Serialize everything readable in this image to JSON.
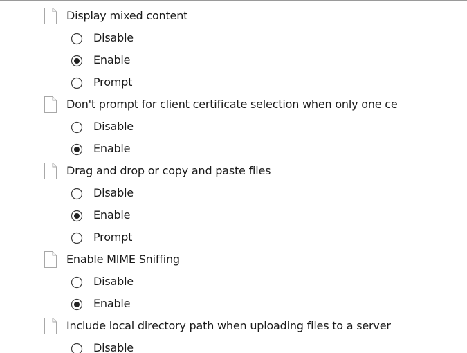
{
  "settings": [
    {
      "label": "Display mixed content",
      "options": [
        {
          "label": "Disable",
          "selected": false
        },
        {
          "label": "Enable",
          "selected": true
        },
        {
          "label": "Prompt",
          "selected": false
        }
      ]
    },
    {
      "label": "Don't prompt for client certificate selection when only one ce",
      "options": [
        {
          "label": "Disable",
          "selected": false
        },
        {
          "label": "Enable",
          "selected": true
        }
      ]
    },
    {
      "label": "Drag and drop or copy and paste files",
      "options": [
        {
          "label": "Disable",
          "selected": false
        },
        {
          "label": "Enable",
          "selected": true
        },
        {
          "label": "Prompt",
          "selected": false
        }
      ]
    },
    {
      "label": "Enable MIME Sniffing",
      "options": [
        {
          "label": "Disable",
          "selected": false
        },
        {
          "label": "Enable",
          "selected": true
        }
      ]
    },
    {
      "label": "Include local directory path when uploading files to a server",
      "options": [
        {
          "label": "Disable",
          "selected": false
        }
      ]
    }
  ],
  "icons": {
    "setting": "document-icon",
    "radio_unselected": "radio-unselected-icon",
    "radio_selected": "radio-selected-icon"
  },
  "colors": {
    "icon_border": "#a8a8a8",
    "radio_border": "#3c3c3c",
    "radio_dot": "#222222",
    "text": "#1a1a1a"
  }
}
